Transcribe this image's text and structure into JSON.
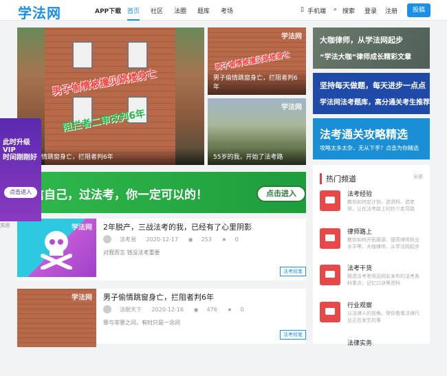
{
  "header": {
    "logo": "学法网",
    "nav": [
      {
        "label": "APP下载",
        "name": "nav-app-download"
      },
      {
        "label": "首页",
        "name": "nav-home"
      },
      {
        "label": "社区",
        "name": "nav-community"
      },
      {
        "label": "法圈",
        "name": "nav-law-circle"
      },
      {
        "label": "题库",
        "name": "nav-question-bank"
      },
      {
        "label": "考场",
        "name": "nav-exam-room"
      }
    ],
    "mobile": "手机端",
    "search": "搜索",
    "login": "登录",
    "register": "注册",
    "post_button": "投稿"
  },
  "featured": {
    "main": {
      "caption": "男子偷情跳窗身亡，拦阻者判6年",
      "overlay_red": "男子偷情被撞见跳楼身亡",
      "overlay_green": "阻拦者二审改判6年"
    },
    "small1": {
      "caption": "男子偷情跳窗身亡，拦阻者判6年",
      "overlay": "男子偷情被撞见跳楼身亡",
      "watermark": "学法网"
    },
    "small2": {
      "caption": "55岁的我，开始了法考路",
      "watermark": "学法网"
    }
  },
  "side_banners": [
    {
      "line1": "大咖律师，从学法网起步",
      "line2": "“学法大咖”律师成长精彩文章"
    },
    {
      "line1": "坚持每天做题，每天进步一点点",
      "line2": "学法网法考题库，高分通关考生推荐"
    },
    {
      "line1": "法考通关攻略精选",
      "line2": "攻略太多太杂，无从下手？点击为你精选"
    }
  ],
  "wide_banner": {
    "text": "相信自己，过法考，你一定可以的！",
    "button": "点击进入"
  },
  "vip_float": {
    "line1": "此时升级VIP",
    "line2": "时间刚刚好",
    "button": "点击进入",
    "close": "关闭"
  },
  "articles": [
    {
      "title": "2年脱产，三战法考的我，已经有了心里阴影",
      "author": "法考易",
      "date": "2020-12-17",
      "views": "253",
      "likes": "0",
      "desc": "对我而言 钱没法考重要",
      "tag": "法考段笔",
      "watermark": "学法网"
    },
    {
      "title": "男子偷情跳窗身亡，拦阻者判6年",
      "author": "法眼天下",
      "date": "2020-12-16",
      "views": "476",
      "likes": "0",
      "desc": "罪与非罪之间，有时只是一念间",
      "tag": "法考段笔",
      "watermark": "学法网"
    }
  ],
  "hot_channels": {
    "title": "热门频道",
    "more": "全部",
    "items": [
      {
        "name": "法考经验",
        "desc": "教你如何定计划、选资料、选老师，让在法考路上的抄少走弯路"
      },
      {
        "name": "律师路上",
        "desc": "教你如何开拓案源、提高律师执业水平等，大咖律师，从学法网起步"
      },
      {
        "name": "法考干货",
        "desc": "精选法考老师及网友发布的法考各科重点，记忆口诀等资料"
      },
      {
        "name": "行业观察",
        "desc": "以法律人的视角，带你看看法律行业正在发生的事"
      },
      {
        "name": "法律实务",
        "desc": ""
      }
    ]
  }
}
